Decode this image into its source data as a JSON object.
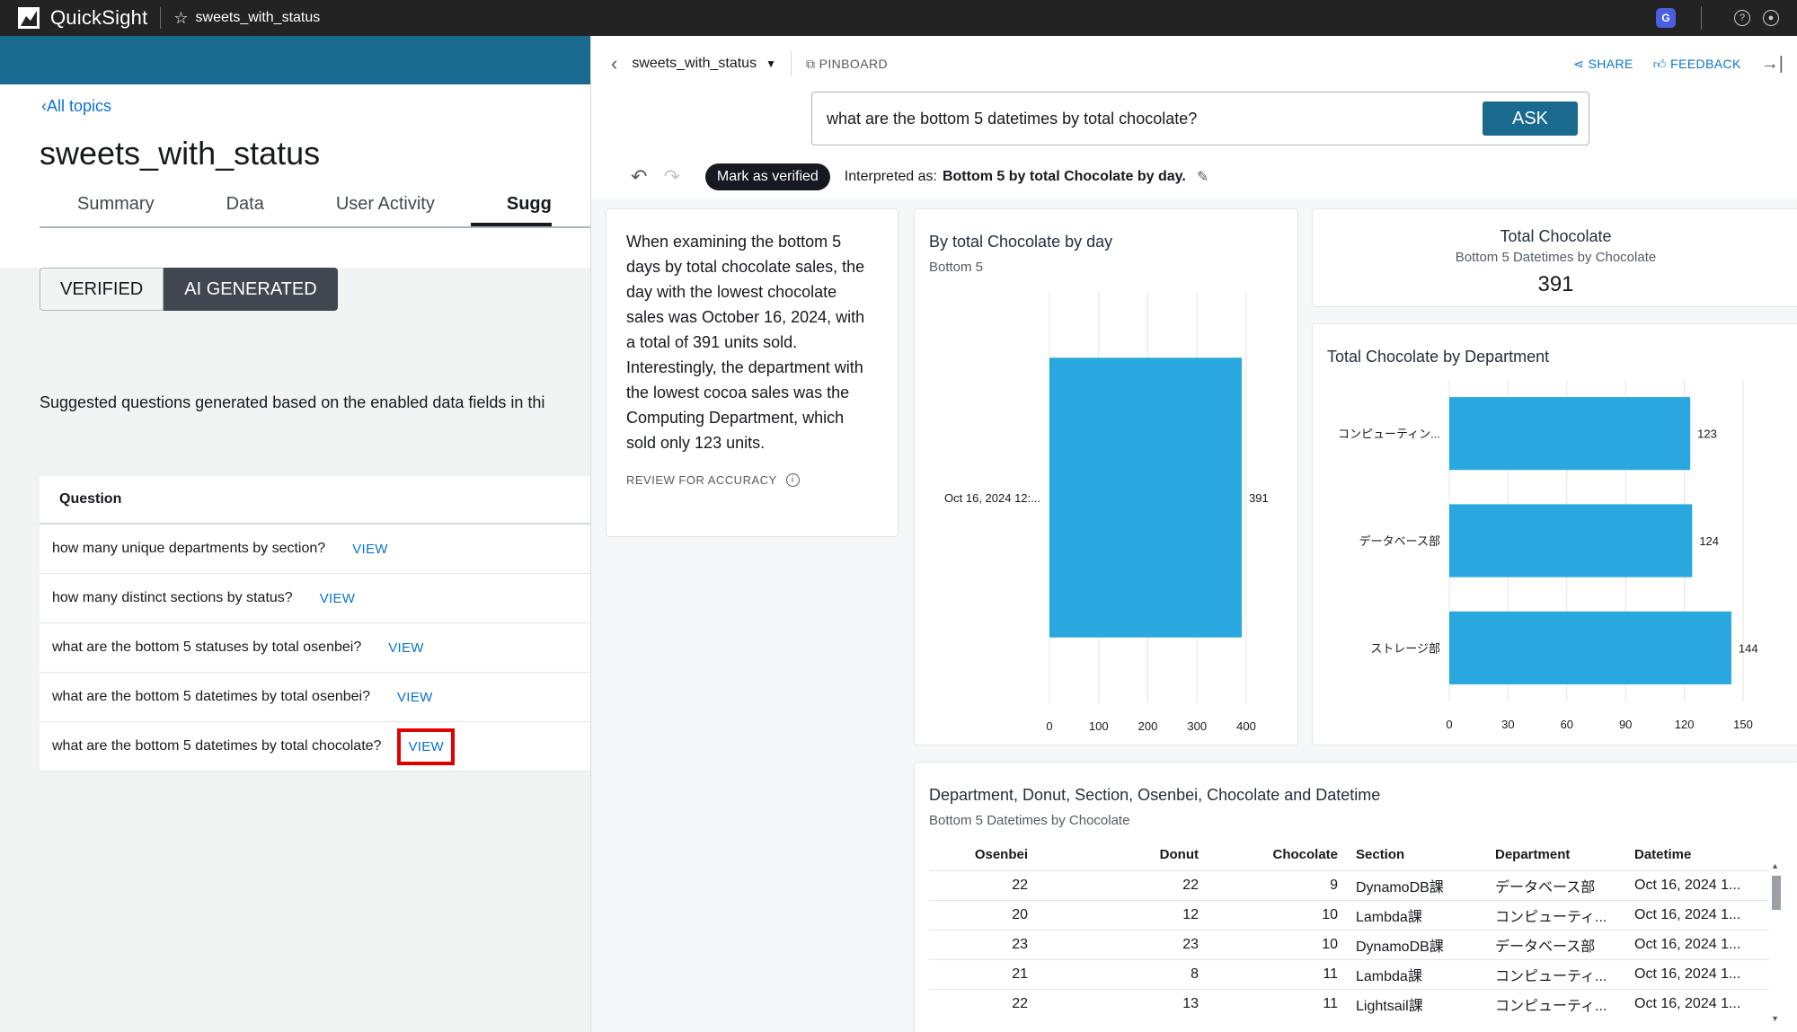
{
  "topbar": {
    "app_name": "QuickSight",
    "analysis_title": "sweets_with_status",
    "badge_letter": "G"
  },
  "left": {
    "back_link": "All topics",
    "title": "sweets_with_status",
    "tabs": [
      {
        "label": "Summary"
      },
      {
        "label": "Data"
      },
      {
        "label": "User Activity"
      },
      {
        "label": "Sugg"
      }
    ],
    "segment": {
      "verified": "VERIFIED",
      "ai_generated": "AI GENERATED"
    },
    "suggested_text": "Suggested questions generated based on the enabled data fields in thi",
    "table_header": "Question",
    "view_label": "VIEW",
    "questions": [
      "how many unique departments by section?",
      "how many distinct sections by status?",
      "what are the bottom 5 statuses by total osenbei?",
      "what are the bottom 5 datetimes by total osenbei?",
      "what are the bottom 5 datetimes by total chocolate?"
    ]
  },
  "panel": {
    "topic": "sweets_with_status",
    "pinboard": "PINBOARD",
    "share": "SHARE",
    "feedback": "FEEDBACK",
    "ask_value": "what are the bottom 5 datetimes by total chocolate?",
    "ask_button": "ASK",
    "mark_verified": "Mark as verified",
    "interpreted_label": "Interpreted as:",
    "interpreted_value": "Bottom 5 by total Chocolate by day.",
    "narrative": "When examining the bottom 5 days by total chocolate sales, the day with the lowest chocolate sales was October 16, 2024, with a total of 391 units sold. Interestingly, the department with the lowest cocoa sales was the Computing Department, which sold only 123 units.",
    "review": "REVIEW FOR ACCURACY",
    "kpi": {
      "title": "Total Chocolate",
      "subtitle": "Bottom 5 Datetimes by Chocolate",
      "value": "391"
    },
    "table": {
      "title": "Department, Donut, Section, Osenbei, Chocolate and Datetime",
      "subtitle": "Bottom 5 Datetimes by Chocolate",
      "columns": [
        "Osenbei",
        "Donut",
        "Chocolate",
        "Section",
        "Department",
        "Datetime"
      ],
      "rows": [
        [
          "22",
          "22",
          "9",
          "DynamoDB課",
          "データベース部",
          "Oct 16, 2024 1..."
        ],
        [
          "20",
          "12",
          "10",
          "Lambda課",
          "コンピューティ...",
          "Oct 16, 2024 1..."
        ],
        [
          "23",
          "23",
          "10",
          "DynamoDB課",
          "データベース部",
          "Oct 16, 2024 1..."
        ],
        [
          "21",
          "8",
          "11",
          "Lambda課",
          "コンピューティ...",
          "Oct 16, 2024 1..."
        ],
        [
          "22",
          "13",
          "11",
          "Lightsail課",
          "コンピューティ...",
          "Oct 16, 2024 1..."
        ]
      ]
    }
  },
  "chart_data": [
    {
      "type": "bar",
      "orientation": "horizontal",
      "title": "By total Chocolate by day",
      "subtitle": "Bottom 5",
      "categories": [
        "Oct 16, 2024 12:..."
      ],
      "values": [
        391
      ],
      "xlim": [
        0,
        400
      ],
      "xticks": [
        0,
        100,
        200,
        300,
        400
      ],
      "bar_color": "#29a7df",
      "grid": true
    },
    {
      "type": "bar",
      "orientation": "horizontal",
      "title": "Total Chocolate by Department",
      "categories": [
        "コンピューティン...",
        "データベース部",
        "ストレージ部"
      ],
      "values": [
        123,
        124,
        144
      ],
      "xlim": [
        0,
        150
      ],
      "xticks": [
        0,
        30,
        60,
        90,
        120,
        150
      ],
      "bar_color": "#29a7df",
      "grid": true
    }
  ]
}
